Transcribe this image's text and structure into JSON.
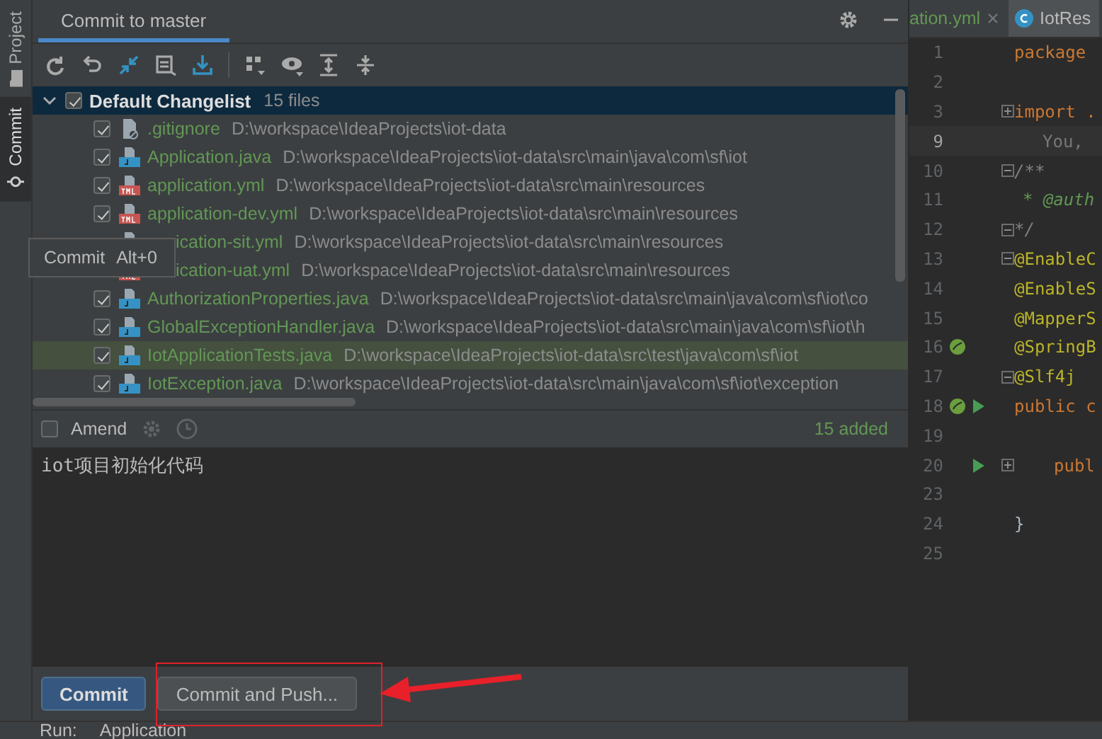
{
  "side_tabs": [
    {
      "label": "Project",
      "selected": false
    },
    {
      "label": "Commit",
      "selected": true
    }
  ],
  "panel": {
    "title": "Commit to master"
  },
  "changelist": {
    "name": "Default Changelist",
    "count": "15 files",
    "checked": true,
    "expanded": true
  },
  "files": [
    {
      "name": ".gitignore",
      "path": "D:\\workspace\\IdeaProjects\\iot-data",
      "kind": "gitignore",
      "checked": true,
      "selected": false,
      "obscured": false
    },
    {
      "name": "Application.java",
      "path": "D:\\workspace\\IdeaProjects\\iot-data\\src\\main\\java\\com\\sf\\iot",
      "kind": "java",
      "checked": true,
      "selected": false,
      "obscured": false
    },
    {
      "name": "application.yml",
      "path": "D:\\workspace\\IdeaProjects\\iot-data\\src\\main\\resources",
      "kind": "yml",
      "checked": true,
      "selected": false,
      "obscured": false
    },
    {
      "name": "application-dev.yml",
      "path": "D:\\workspace\\IdeaProjects\\iot-data\\src\\main\\resources",
      "kind": "yml",
      "checked": true,
      "selected": false,
      "obscured": false
    },
    {
      "name": "ication-sit.yml",
      "path": "D:\\workspace\\IdeaProjects\\iot-data\\src\\main\\resources",
      "kind": "yml",
      "selected": false,
      "obscured": true
    },
    {
      "name": "ication-uat.yml",
      "path": "D:\\workspace\\IdeaProjects\\iot-data\\src\\main\\resources",
      "kind": "yml",
      "selected": false,
      "obscured": true
    },
    {
      "name": "AuthorizationProperties.java",
      "path": "D:\\workspace\\IdeaProjects\\iot-data\\src\\main\\java\\com\\sf\\iot\\co",
      "kind": "java",
      "checked": true,
      "selected": false,
      "obscured": false
    },
    {
      "name": "GlobalExceptionHandler.java",
      "path": "D:\\workspace\\IdeaProjects\\iot-data\\src\\main\\java\\com\\sf\\iot\\h",
      "kind": "java",
      "checked": true,
      "selected": false,
      "obscured": false
    },
    {
      "name": "IotApplicationTests.java",
      "path": "D:\\workspace\\IdeaProjects\\iot-data\\src\\test\\java\\com\\sf\\iot",
      "kind": "java",
      "checked": true,
      "selected": true,
      "obscured": false
    },
    {
      "name": "IotException.java",
      "path": "D:\\workspace\\IdeaProjects\\iot-data\\src\\main\\java\\com\\sf\\iot\\exception",
      "kind": "java",
      "checked": true,
      "selected": false,
      "obscured": false
    }
  ],
  "tooltip": {
    "label": "Commit",
    "shortcut": "Alt+0"
  },
  "amend": {
    "label": "Amend",
    "checked": false
  },
  "summary": "15 added",
  "message": "iot项目初始化代码",
  "buttons": [
    {
      "label": "Commit",
      "kind": "primary"
    },
    {
      "label": "Commit and Push...",
      "kind": "secondary"
    }
  ],
  "editor": {
    "tabs": [
      {
        "label": "ation.yml",
        "kind": "yml",
        "selected": false
      },
      {
        "label": "IotRes",
        "kind": "class",
        "selected": true
      }
    ],
    "lines": [
      {
        "number": "1",
        "code": "package",
        "kind": "keyword",
        "current": false
      },
      {
        "number": "2",
        "kind": "plain",
        "current": false
      },
      {
        "number": "3",
        "code": "import .",
        "kind": "keyword",
        "fold": {
          "kind": "expand"
        },
        "current": false
      },
      {
        "number": "9",
        "code": "You,",
        "kind": "hint",
        "current": true
      },
      {
        "number": "10",
        "code": "/**",
        "kind": "comment",
        "fold": {
          "kind": "collapse"
        },
        "current": false
      },
      {
        "number": "11",
        "code": "* @auth",
        "kind": "doc",
        "current": false
      },
      {
        "number": "12",
        "code": "*/",
        "kind": "comment",
        "fold": {
          "kind": "collapse"
        },
        "current": false
      },
      {
        "number": "13",
        "code": "@EnableC",
        "kind": "annotation",
        "fold": {
          "kind": "collapse"
        },
        "current": false
      },
      {
        "number": "14",
        "code": "@EnableS",
        "kind": "annotation",
        "current": false
      },
      {
        "number": "15",
        "code": "@MapperS",
        "kind": "annotation",
        "current": false
      },
      {
        "number": "16",
        "code": "@SpringB",
        "kind": "annotation",
        "gutter": [
          {
            "kind": "bean"
          }
        ],
        "current": false
      },
      {
        "number": "17",
        "code": "@Slf4j",
        "kind": "annotation",
        "fold": {
          "kind": "collapse"
        },
        "current": false
      },
      {
        "number": "18",
        "code": "public c",
        "kind": "keyword",
        "gutter": [
          {
            "kind": "bean"
          },
          {
            "kind": "run"
          }
        ],
        "current": false
      },
      {
        "number": "19",
        "kind": "plain",
        "current": false
      },
      {
        "number": "20",
        "code": "publ",
        "kind": "keyword-indent",
        "gutter": [
          {
            "kind": "run"
          }
        ],
        "fold": {
          "kind": "expand"
        },
        "current": false
      },
      {
        "number": "23",
        "kind": "plain",
        "current": false
      },
      {
        "number": "24",
        "code": "}",
        "kind": "plain",
        "current": false
      },
      {
        "number": "25",
        "kind": "plain",
        "current": false
      }
    ]
  },
  "bottom_bar": {
    "label": "Run:",
    "config": "Application"
  }
}
